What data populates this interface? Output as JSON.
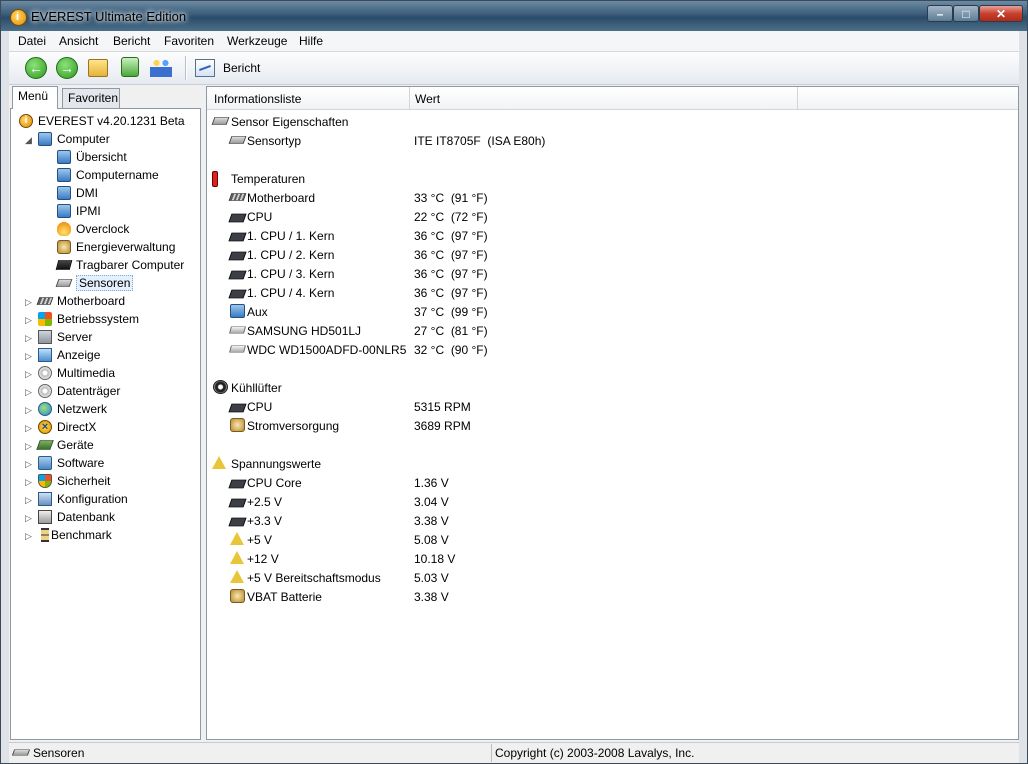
{
  "window": {
    "title": "EVEREST Ultimate Edition",
    "min_glyph": "–",
    "max_glyph": "□",
    "close_glyph": "✕"
  },
  "menu": [
    "Datei",
    "Ansicht",
    "Bericht",
    "Favoriten",
    "Werkzeuge",
    "Hilfe"
  ],
  "toolbar": {
    "report_label": "Bericht"
  },
  "tabs": {
    "menu": "Menü",
    "favorites": "Favoriten"
  },
  "tree": {
    "root": "EVEREST v4.20.1231 Beta",
    "computer": "Computer",
    "computer_children": [
      "Übersicht",
      "Computername",
      "DMI",
      "IPMI",
      "Overclock",
      "Energieverwaltung",
      "Tragbarer Computer",
      "Sensoren"
    ],
    "top_items": [
      "Motherboard",
      "Betriebssystem",
      "Server",
      "Anzeige",
      "Multimedia",
      "Datenträger",
      "Netzwerk",
      "DirectX",
      "Geräte",
      "Software",
      "Sicherheit",
      "Konfiguration",
      "Datenbank",
      "Benchmark"
    ],
    "selected": "Sensoren"
  },
  "columns": {
    "field": "Informationsliste",
    "value": "Wert"
  },
  "sections": {
    "sensor": {
      "title": "Sensor Eigenschaften",
      "rows": [
        {
          "k": "Sensortyp",
          "v": "ITE IT8705F  (ISA E80h)"
        }
      ]
    },
    "temps": {
      "title": "Temperaturen",
      "rows": [
        {
          "k": "Motherboard",
          "v": "33 °C  (91 °F)"
        },
        {
          "k": "CPU",
          "v": "22 °C  (72 °F)"
        },
        {
          "k": "1. CPU / 1. Kern",
          "v": "36 °C  (97 °F)"
        },
        {
          "k": "1. CPU / 2. Kern",
          "v": "36 °C  (97 °F)"
        },
        {
          "k": "1. CPU / 3. Kern",
          "v": "36 °C  (97 °F)"
        },
        {
          "k": "1. CPU / 4. Kern",
          "v": "36 °C  (97 °F)"
        },
        {
          "k": "Aux",
          "v": "37 °C  (99 °F)"
        },
        {
          "k": "SAMSUNG HD501LJ",
          "v": "27 °C  (81 °F)"
        },
        {
          "k": "WDC WD1500ADFD-00NLR5",
          "v": "32 °C  (90 °F)"
        }
      ]
    },
    "fans": {
      "title": "Kühllüfter",
      "rows": [
        {
          "k": "CPU",
          "v": "5315 RPM"
        },
        {
          "k": "Stromversorgung",
          "v": "3689 RPM"
        }
      ]
    },
    "volts": {
      "title": "Spannungswerte",
      "rows": [
        {
          "k": "CPU Core",
          "v": "1.36 V"
        },
        {
          "k": "+2.5 V",
          "v": "3.04 V"
        },
        {
          "k": "+3.3 V",
          "v": "3.38 V"
        },
        {
          "k": "+5 V",
          "v": "5.08 V"
        },
        {
          "k": "+12 V",
          "v": "10.18 V"
        },
        {
          "k": "+5 V Bereitschaftsmodus",
          "v": "5.03 V"
        },
        {
          "k": "VBAT Batterie",
          "v": "3.38 V"
        }
      ]
    }
  },
  "status": {
    "left": "Sensoren",
    "right": "Copyright (c) 2003-2008 Lavalys, Inc."
  }
}
